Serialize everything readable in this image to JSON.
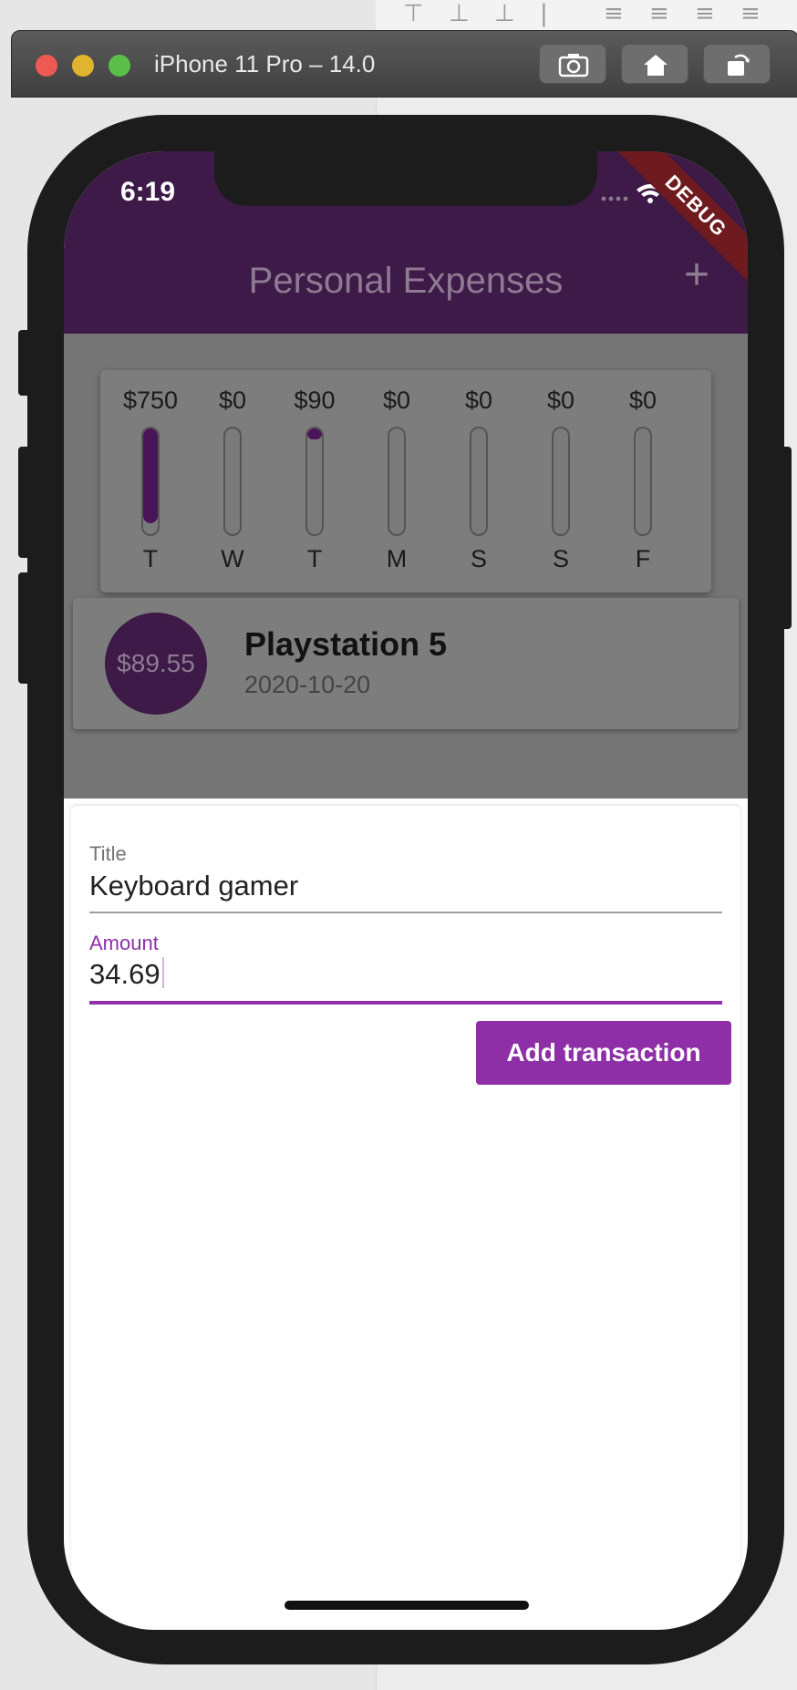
{
  "simulator": {
    "title": "iPhone 11 Pro – 14.0",
    "buttons": [
      "screenshot-icon",
      "home-icon",
      "rotate-icon"
    ]
  },
  "status_bar": {
    "time": "6:19",
    "debug_label": "DEBUG"
  },
  "app_bar": {
    "title": "Personal Expenses",
    "add_icon": "+"
  },
  "chart_data": {
    "type": "bar",
    "categories": [
      "T",
      "W",
      "T",
      "M",
      "S",
      "S",
      "F"
    ],
    "value_labels": [
      "$750",
      "$0",
      "$90",
      "$0",
      "$0",
      "$0",
      "$0"
    ],
    "values": [
      750,
      0,
      90,
      0,
      0,
      0,
      0
    ],
    "fill_fraction": [
      0.9,
      0,
      0.1,
      0,
      0,
      0,
      0
    ]
  },
  "transaction": {
    "amount": "$89.55",
    "title": "Playstation 5",
    "date": "2020-10-20"
  },
  "form": {
    "title_label": "Title",
    "title_value": "Keyboard gamer",
    "amount_label": "Amount",
    "amount_value": "34.69",
    "submit_label": "Add transaction"
  },
  "colors": {
    "primary": "#8e2fa8",
    "app_bar": "#3d1a47",
    "debug": "#6e1a1e"
  }
}
